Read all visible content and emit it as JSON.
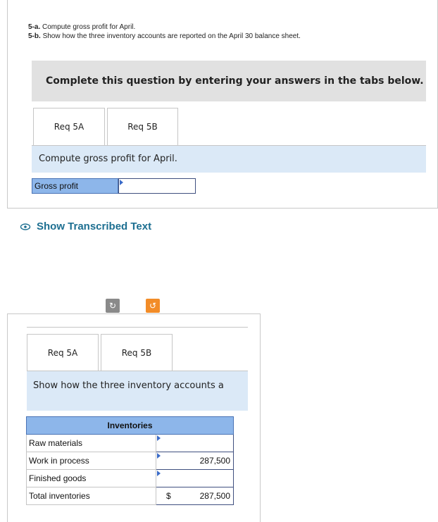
{
  "question": {
    "part_a_num": "5-a.",
    "part_a_text": "Compute gross profit for April.",
    "part_b_num": "5-b.",
    "part_b_text": "Show how the three inventory accounts are reported on the April 30 balance sheet."
  },
  "banner": "Complete this question by entering your answers in the tabs below.",
  "panel1": {
    "tabs": [
      "Req 5A",
      "Req 5B"
    ],
    "instruction": "Compute gross profit for April.",
    "field_label": "Gross profit",
    "field_value": ""
  },
  "show_transcribed": "Show Transcribed Text",
  "panel2": {
    "tabs": [
      "Req 5A",
      "Req 5B"
    ],
    "instruction": "Show how the three inventory accounts a",
    "table_header": "Inventories",
    "rows": [
      {
        "label": "Raw materials",
        "currency": "",
        "value": ""
      },
      {
        "label": "Work in process",
        "currency": "",
        "value": "287,500"
      },
      {
        "label": "Finished goods",
        "currency": "",
        "value": ""
      },
      {
        "label": "Total inventories",
        "currency": "$",
        "value": "287,500"
      }
    ]
  },
  "colors": {
    "header_blue": "#8db6ea",
    "band_blue": "#dbe9f7",
    "link_teal": "#1d6f91",
    "orange": "#f28c28",
    "gray_btn": "#8a8a8a"
  },
  "icons": [
    "eye-icon",
    "undo-icon",
    "redo-icon"
  ]
}
